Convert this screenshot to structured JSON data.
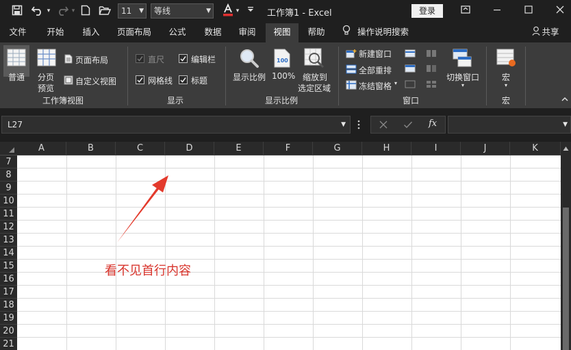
{
  "titlebar": {
    "title": "工作簿1  -  Excel",
    "font_size": "11",
    "font_name": "等线",
    "login_label": "登录"
  },
  "menu": {
    "tabs": [
      "文件",
      "开始",
      "插入",
      "页面布局",
      "公式",
      "数据",
      "审阅",
      "视图",
      "帮助",
      "操作说明搜索"
    ],
    "active_tab": "视图",
    "share_label": "共享"
  },
  "ribbon": {
    "workbook_view": {
      "normal": "普通",
      "page_break_1": "分页",
      "page_break_2": "预览",
      "page_layout": "页面布局",
      "custom_view": "自定义视图",
      "group_label": "工作簿视图"
    },
    "show": {
      "ruler": "直尺",
      "formula_bar": "编辑栏",
      "gridlines": "网格线",
      "headings": "标题",
      "group_label": "显示"
    },
    "zoom": {
      "zoom": "显示比例",
      "hundred": "100%",
      "zoom_sel_1": "缩放到",
      "zoom_sel_2": "选定区域",
      "group_label": "显示比例"
    },
    "window": {
      "new_window": "新建窗口",
      "arrange_all": "全部重排",
      "freeze_panes": "冻结窗格",
      "switch_window": "切换窗口",
      "group_label": "窗口"
    },
    "macros": {
      "macro": "宏",
      "group_label": "宏"
    }
  },
  "formula_bar": {
    "name_box": "L27",
    "fx_label": "fx",
    "formula_value": ""
  },
  "sheet": {
    "columns": [
      "A",
      "B",
      "C",
      "D",
      "E",
      "F",
      "G",
      "H",
      "I",
      "J",
      "K"
    ],
    "rows": [
      "7",
      "8",
      "9",
      "10",
      "11",
      "12",
      "13",
      "14",
      "15",
      "16",
      "17",
      "18",
      "19",
      "20",
      "21"
    ]
  },
  "annotation": {
    "text": "看不见首行内容",
    "color": "#d8342c"
  },
  "colors": {
    "chrome_bg": "#1f1f1f",
    "ribbon_bg": "#3c3c3c",
    "header_bg": "#2a2a2a",
    "font_color_accent": "#e03030"
  }
}
